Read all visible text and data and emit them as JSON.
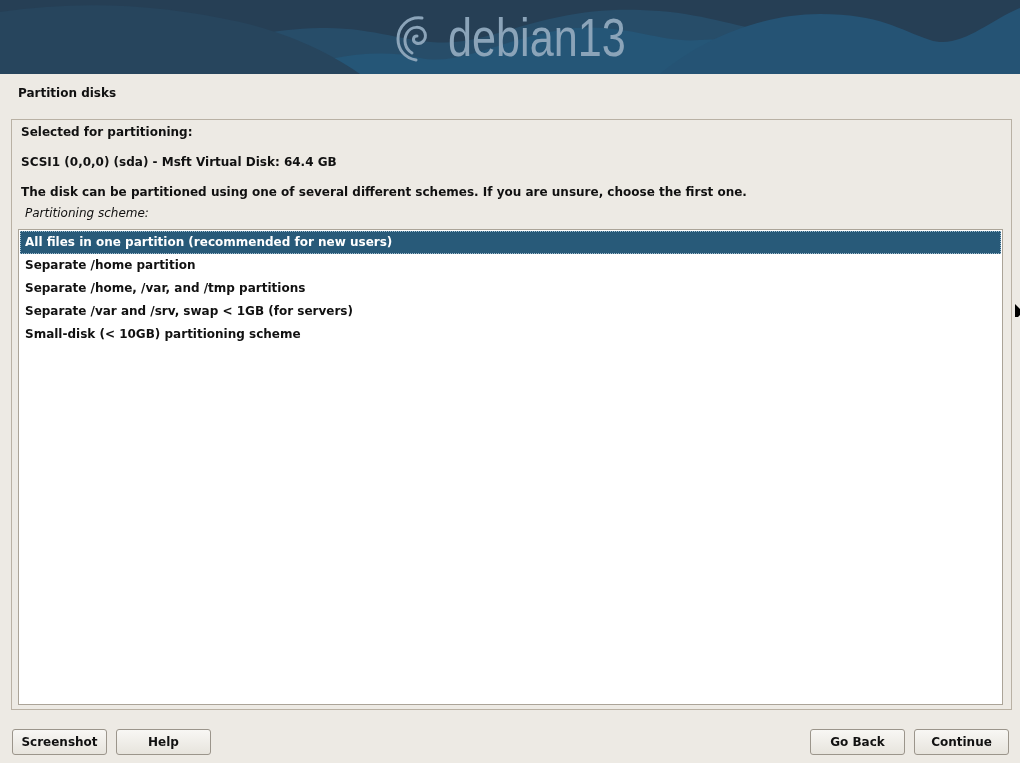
{
  "banner": {
    "logo_text": "debian13"
  },
  "title": "Partition disks",
  "selected_label": "Selected for partitioning:",
  "disk": "SCSI1 (0,0,0) (sda) - Msft Virtual Disk: 64.4 GB",
  "description": "The disk can be partitioned using one of several different schemes. If you are unsure, choose the first one.",
  "list_label": "Partitioning scheme:",
  "schemes": [
    {
      "label": "All files in one partition (recommended for new users)",
      "selected": true
    },
    {
      "label": "Separate /home partition",
      "selected": false
    },
    {
      "label": "Separate /home, /var, and /tmp partitions",
      "selected": false
    },
    {
      "label": "Separate /var and /srv, swap < 1GB (for servers)",
      "selected": false
    },
    {
      "label": "Small-disk (< 10GB) partitioning scheme",
      "selected": false
    }
  ],
  "buttons_left": [
    "Screenshot",
    "Help"
  ],
  "buttons_right": [
    "Go Back",
    "Continue"
  ]
}
